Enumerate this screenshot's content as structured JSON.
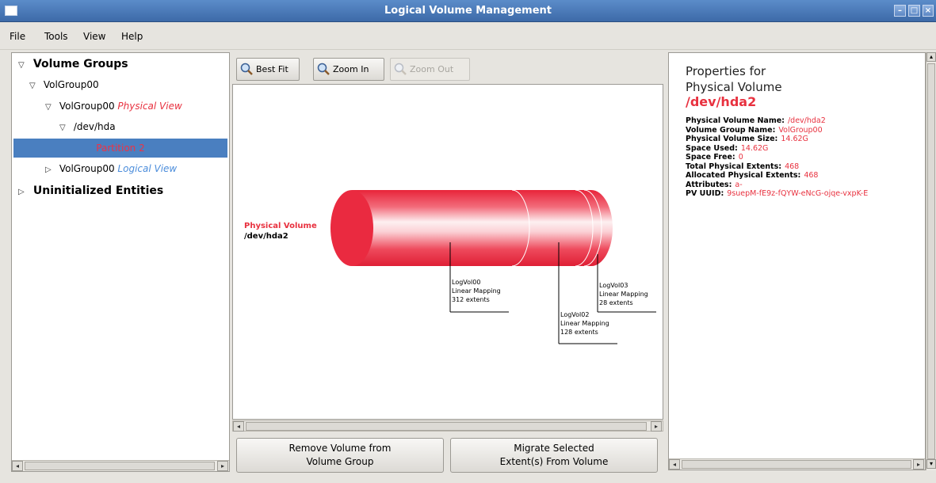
{
  "window": {
    "title": "Logical Volume Management"
  },
  "menu": {
    "file": "File",
    "tools": "Tools",
    "view": "View",
    "help": "Help"
  },
  "tree": {
    "volume_groups": "Volume Groups",
    "vg": "VolGroup00",
    "vg_physical": "VolGroup00",
    "physical_view": "Physical View",
    "disk": "/dev/hda",
    "partition": "Partition 2",
    "vg_logical": "VolGroup00",
    "logical_view": "Logical View",
    "uninitialized": "Uninitialized Entities"
  },
  "toolbar": {
    "best_fit": "Best Fit",
    "zoom_in": "Zoom In",
    "zoom_out": "Zoom Out"
  },
  "diagram": {
    "pv_label": "Physical Volume",
    "pv_device": "/dev/hda2",
    "segments": [
      {
        "name": "LogVol00",
        "mapping": "Linear Mapping",
        "extents": "312 extents"
      },
      {
        "name": "LogVol02",
        "mapping": "Linear Mapping",
        "extents": "128 extents"
      },
      {
        "name": "LogVol03",
        "mapping": "Linear Mapping",
        "extents": "28 extents"
      }
    ]
  },
  "actions": {
    "remove_line1": "Remove Volume from",
    "remove_line2": "Volume Group",
    "migrate_line1": "Migrate Selected",
    "migrate_line2": "Extent(s) From Volume"
  },
  "properties": {
    "heading1": "Properties for",
    "heading2": "Physical Volume",
    "device": "/dev/hda2",
    "items": [
      {
        "key": "Physical Volume Name:",
        "value": "/dev/hda2"
      },
      {
        "key": "Volume Group Name:",
        "value": "VolGroup00"
      },
      {
        "key": "Physical Volume Size:",
        "value": "14.62G"
      },
      {
        "key": "Space Used:",
        "value": "14.62G"
      },
      {
        "key": "Space Free:",
        "value": "0"
      },
      {
        "key": "Total Physical Extents:",
        "value": "468"
      },
      {
        "key": "Allocated Physical Extents:",
        "value": "468"
      },
      {
        "key": "Attributes:",
        "value": "a-"
      },
      {
        "key": "PV UUID:",
        "value": "9suepM-fE9z-fQYW-eNcG-ojqe-vxpK-E"
      }
    ]
  },
  "colors": {
    "accent": "#e8313f",
    "selection": "#4a7fc0",
    "link_blue": "#4c8ddb"
  }
}
